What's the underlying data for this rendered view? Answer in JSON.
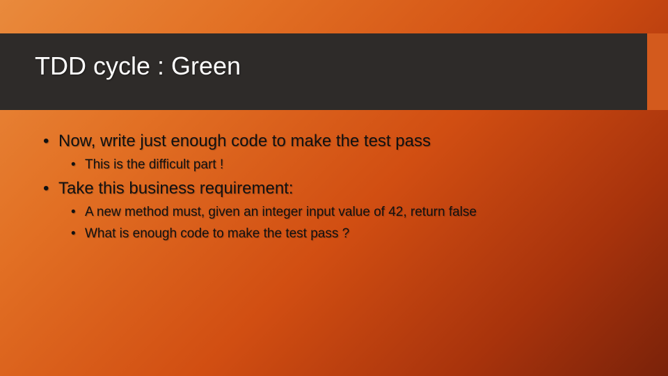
{
  "title": "TDD cycle : Green",
  "bullets": {
    "b1": "Now, write just enough code to make the test pass",
    "b1_1": "This is the difficult part !",
    "b2": "Take this business requirement:",
    "b2_1": "A new method must, given an integer input value of 42, return false",
    "b2_2": "What is enough code to make the test pass ?"
  }
}
